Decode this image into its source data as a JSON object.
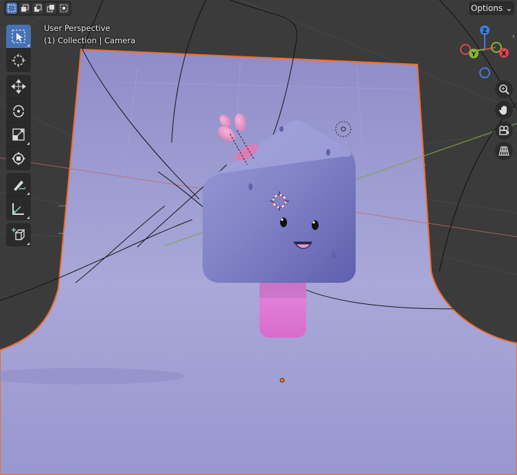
{
  "viewport": {
    "view_name": "User Perspective",
    "collection_info": "(1) Collection | Camera"
  },
  "header": {
    "options_label": "Options",
    "selection_modes": [
      "select-new-icon",
      "select-extend-icon",
      "select-subtract-icon",
      "select-difference-icon",
      "select-intersect-icon"
    ]
  },
  "toolbar": {
    "tools": [
      "select-box-icon",
      "cursor-icon",
      "move-icon",
      "rotate-icon",
      "scale-icon",
      "transform-icon",
      "annotate-icon",
      "measure-icon",
      "add-cube-icon"
    ],
    "active_tool": "select-box-icon"
  },
  "gizmo": {
    "z_label": "Z",
    "y_label": "Y",
    "x_label": "X",
    "colors": {
      "x": "#e0434f",
      "y": "#82b833",
      "z": "#3c7ee0"
    }
  },
  "nav": [
    "zoom-icon",
    "pan-hand-icon",
    "camera-view-icon",
    "perspective-grid-icon"
  ],
  "colors": {
    "backdrop": "#9c9bd1",
    "selection_outline": "#f26b2a",
    "active_tool": "#4772b3",
    "popsicle_body": "#7c7ec0",
    "popsicle_stick": "#d878d2"
  }
}
